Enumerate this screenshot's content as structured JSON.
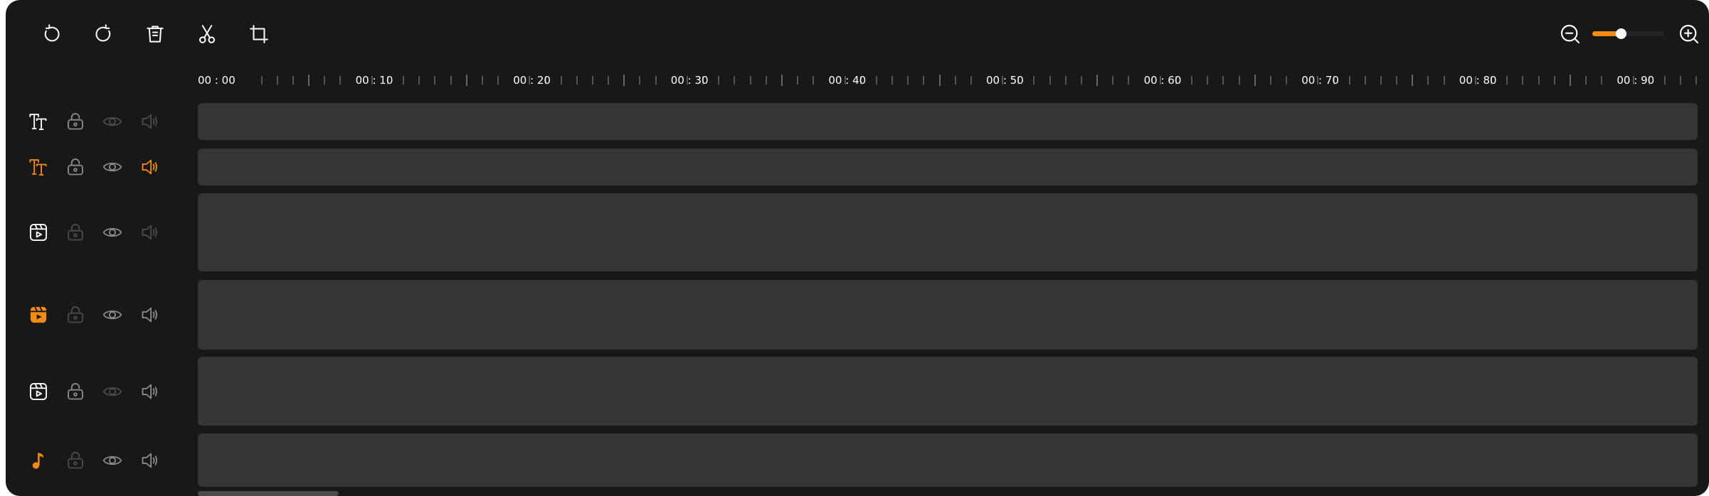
{
  "toolbar": {
    "buttons": [
      {
        "name": "undo-button",
        "icon": "undo-icon"
      },
      {
        "name": "redo-button",
        "icon": "redo-icon"
      },
      {
        "name": "delete-button",
        "icon": "trash-icon"
      },
      {
        "name": "split-button",
        "icon": "scissors-icon"
      },
      {
        "name": "crop-button",
        "icon": "crop-icon"
      }
    ]
  },
  "zoom": {
    "out_icon": "zoom-out-icon",
    "in_icon": "zoom-in-icon",
    "level": 0.4,
    "accent_color": "#f28b12"
  },
  "ruler": {
    "labels": [
      "00 : 00",
      "00 : 10",
      "00 : 20",
      "00 : 30",
      "00 : 40",
      "00 : 50",
      "00 : 60",
      "00 : 70",
      "00 : 80",
      "00 : 90"
    ]
  },
  "tracks": [
    {
      "name": "text-track-1",
      "type_icon": "text-icon",
      "active": false,
      "locked": false,
      "visible": false,
      "muted": true,
      "muted_dim": true
    },
    {
      "name": "text-track-2",
      "type_icon": "text-icon",
      "active": true,
      "locked": false,
      "visible": true,
      "audio_active": true
    },
    {
      "name": "video-track-1",
      "type_icon": "video-icon",
      "active": false,
      "lock_dim": true,
      "visible": true,
      "audio_dim": true
    },
    {
      "name": "video-track-2",
      "type_icon": "video-icon",
      "active": true,
      "lock_dim": true,
      "visible": true
    },
    {
      "name": "video-track-3",
      "type_icon": "video-icon",
      "active": false,
      "visible_dim": true
    },
    {
      "name": "audio-track-1",
      "type_icon": "music-icon",
      "active": true,
      "lock_dim": true,
      "visible": true
    }
  ],
  "colors": {
    "background": "#181818",
    "lane": "#353535",
    "accent": "#f28b12",
    "icon": "#ffffff",
    "icon_muted": "#8a8a8a",
    "icon_dim": "#4a4a4a"
  }
}
